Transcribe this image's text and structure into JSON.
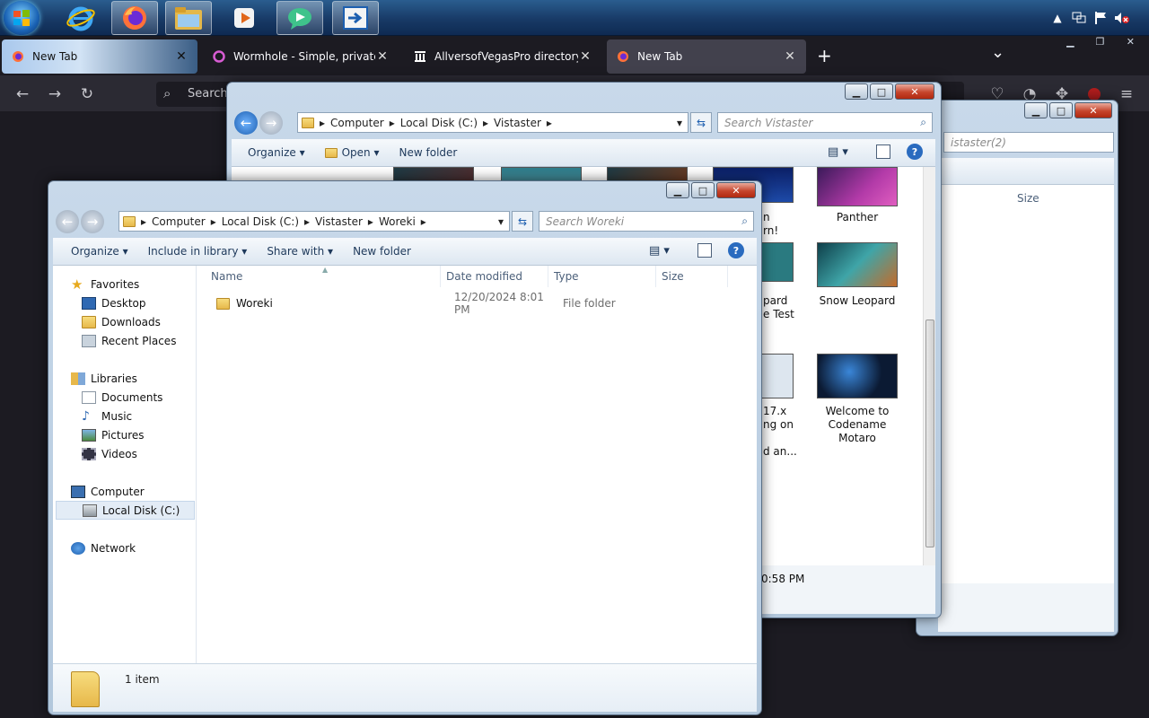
{
  "taskbar": {
    "icons": [
      "start-orb",
      "internet-explorer-icon",
      "firefox-icon",
      "file-explorer-icon",
      "media-player-icon",
      "messenger-icon",
      "remote-app-icon"
    ]
  },
  "tray": {
    "volume_state": "muted"
  },
  "firefox": {
    "tabs": [
      {
        "title": "New Tab"
      },
      {
        "title": "Wormhole - Simple, private file"
      },
      {
        "title": "AllversofVegasPro directory listi"
      },
      {
        "title": "New Tab"
      }
    ],
    "search_placeholder": "Search",
    "new_tab": "+",
    "tabs_menu": "⌄"
  },
  "win_back": {
    "path": [
      "Computer",
      "Local Disk (C:)",
      "Vistaster"
    ],
    "search_placeholder": "Search Vistaster",
    "commands": [
      "Organize",
      "Open",
      "New folder"
    ],
    "items": [
      {
        "label": "Panther"
      },
      {
        "label": "Snow Leopard"
      },
      {
        "label": "Welcome to Codename Motaro"
      }
    ],
    "partial": [
      "n",
      "rn!",
      "pard",
      "e Test",
      "17.x",
      "ng on",
      "d an..."
    ],
    "status": "0:58 PM"
  },
  "win_far": {
    "search_placeholder": "istaster(2)",
    "col_size": "Size"
  },
  "win_front": {
    "path": [
      "Computer",
      "Local Disk (C:)",
      "Vistaster",
      "Woreki"
    ],
    "search_placeholder": "Search Woreki",
    "commands": [
      "Organize",
      "Include in library",
      "Share with",
      "New folder"
    ],
    "nav": {
      "favorites": "Favorites",
      "desktop": "Desktop",
      "downloads": "Downloads",
      "recent": "Recent Places",
      "libraries": "Libraries",
      "documents": "Documents",
      "music": "Music",
      "pictures": "Pictures",
      "videos": "Videos",
      "computer": "Computer",
      "local_disk": "Local Disk (C:)",
      "network": "Network"
    },
    "columns": [
      "Name",
      "Date modified",
      "Type",
      "Size"
    ],
    "rows": [
      {
        "name": "Woreki",
        "date": "12/20/2024 8:01 PM",
        "type": "File folder",
        "size": ""
      }
    ],
    "status": "1 item"
  },
  "colors": {
    "accent": "#1e395b",
    "firefox_bg": "#1c1b22",
    "glass": "#b9cde2"
  }
}
